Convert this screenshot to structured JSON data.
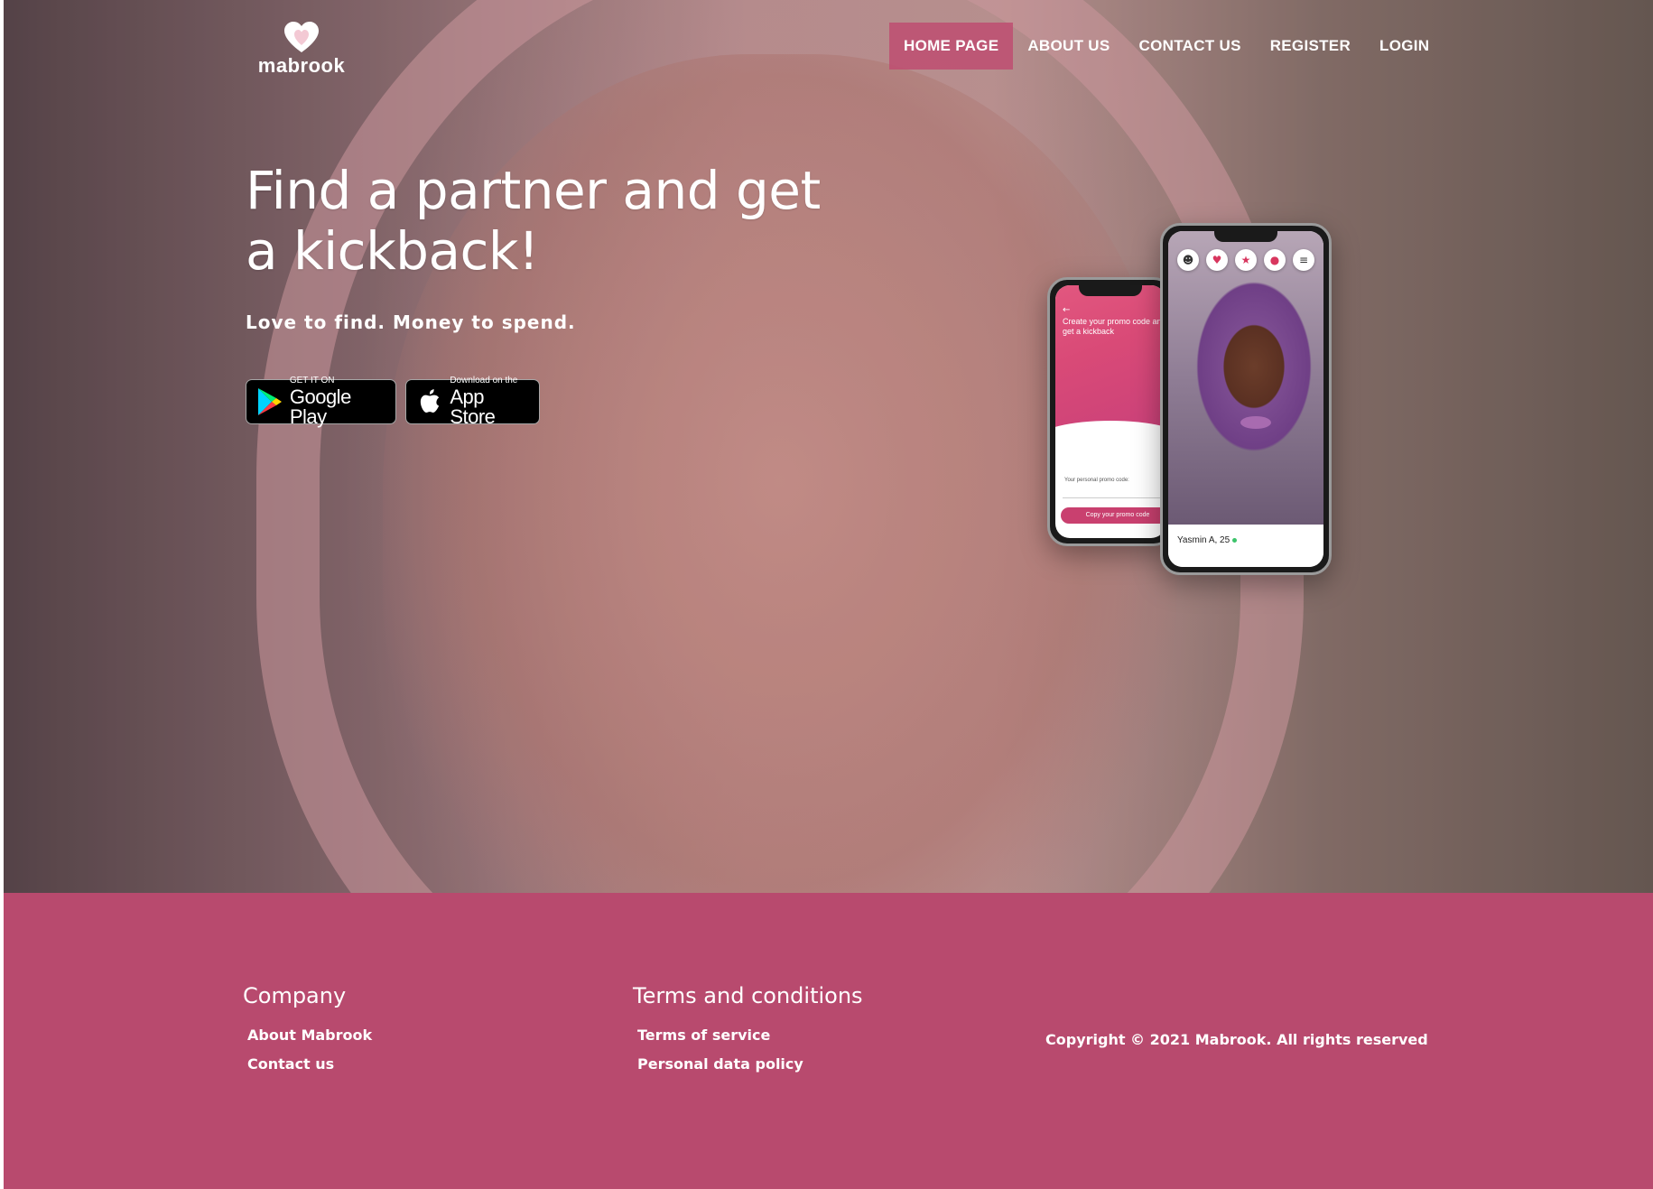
{
  "brand": {
    "name": "mabrook"
  },
  "nav": {
    "items": [
      {
        "label": "HOME PAGE",
        "active": true
      },
      {
        "label": "ABOUT US",
        "active": false
      },
      {
        "label": "CONTACT US",
        "active": false
      },
      {
        "label": "REGISTER",
        "active": false
      },
      {
        "label": "LOGIN",
        "active": false
      }
    ]
  },
  "hero": {
    "headline": "Find a partner and get a kickback!",
    "subheadline": "Love to find. Money to spend."
  },
  "badges": {
    "google": {
      "small": "GET IT ON",
      "big": "Google Play",
      "icon": "google-play-icon"
    },
    "apple": {
      "small": "Download on the",
      "big": "App Store",
      "icon": "apple-icon"
    }
  },
  "phones": {
    "promo": {
      "title": "Create your promo code and get a kickback",
      "field_label": "Your personal promo code:",
      "button": "Copy your promo code"
    },
    "profile": {
      "name": "Yasmin A, 25",
      "icons": [
        "user-icon",
        "heart-icon",
        "star-icon",
        "chat-icon",
        "menu-icon"
      ]
    }
  },
  "footer": {
    "company": {
      "heading": "Company",
      "links": [
        "About Mabrook",
        "Contact us"
      ]
    },
    "terms": {
      "heading": "Terms and conditions",
      "links": [
        "Terms of service",
        "Personal data policy"
      ]
    },
    "copyright": "Copyright © 2021 Mabrook. All rights reserved"
  },
  "colors": {
    "accent": "#b84a6e",
    "nav_active": "#be4e71",
    "promo_gradient": "#e2577f"
  }
}
